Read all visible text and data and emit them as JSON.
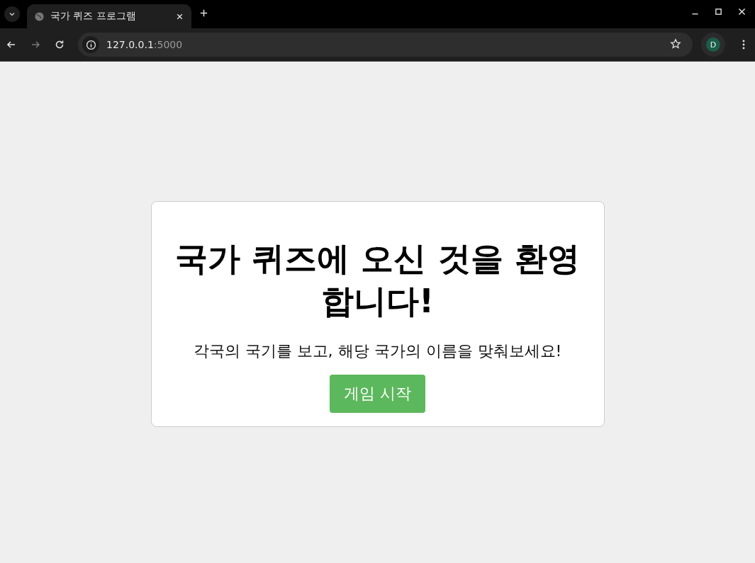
{
  "browser": {
    "tab_title": "국가 퀴즈 프로그램",
    "url_host": "127.0.0.1",
    "url_port": ":5000",
    "profile_initial": "D"
  },
  "card": {
    "title": "국가 퀴즈에 오신 것을 환영합니다!",
    "description": "각국의 국기를 보고, 해당 국가의 이름을 맞춰보세요!",
    "start_button": "게임 시작"
  }
}
